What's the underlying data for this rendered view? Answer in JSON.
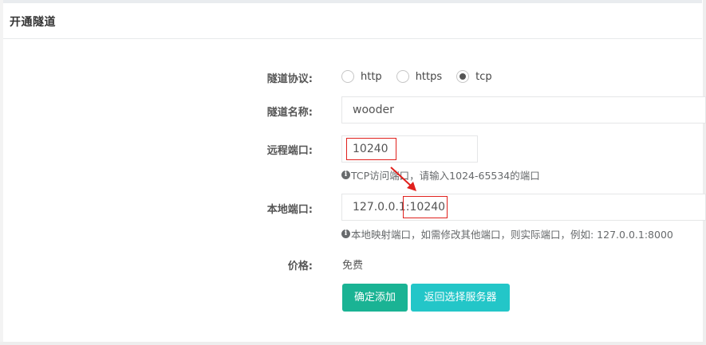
{
  "panel": {
    "title": "开通隧道"
  },
  "form": {
    "protocol": {
      "label": "隧道协议:",
      "options": [
        {
          "label": "http",
          "checked": false
        },
        {
          "label": "https",
          "checked": false
        },
        {
          "label": "tcp",
          "checked": true
        }
      ]
    },
    "name": {
      "label": "隧道名称:",
      "value": "wooder"
    },
    "remote_port": {
      "label": "远程端口:",
      "value": "10240",
      "help": "TCP访问端口，请输入1024-65534的端口"
    },
    "local_port": {
      "label": "本地端口:",
      "value": "127.0.0.1:10240",
      "help": "本地映射端口，如需修改其他端口，则实际端口，例如:  127.0.0.1:8000"
    },
    "price": {
      "label": "价格:",
      "value": "免费"
    }
  },
  "buttons": {
    "confirm": "确定添加",
    "back": "返回选择服务器"
  },
  "colors": {
    "primary": "#1ab394",
    "info": "#23c6c8",
    "annotation": "#e0211d"
  },
  "icons": {
    "help": "info-circle-icon",
    "annotation_arrow": "red-arrow-icon"
  }
}
